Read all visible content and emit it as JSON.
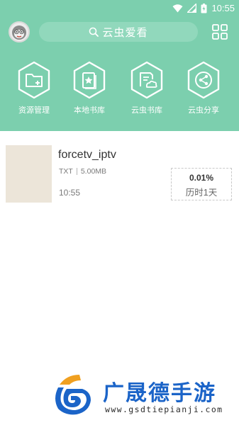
{
  "colors": {
    "header_bg": "#7ccfae",
    "search_bg": "#91d8bc",
    "cover_bg": "#ece5d9",
    "watermark_blue": "#1b64c8"
  },
  "status_bar": {
    "time": "10:55",
    "icons": [
      "wifi-icon",
      "signal-icon",
      "battery-icon"
    ]
  },
  "header": {
    "avatar_icon": "avatar-face-icon",
    "search_placeholder": "云虫爱看",
    "search_icon": "search-icon",
    "menu_icon": "grid-icon"
  },
  "nav": {
    "items": [
      {
        "label": "资源管理",
        "icon": "folder-add-icon"
      },
      {
        "label": "本地书库",
        "icon": "star-book-icon"
      },
      {
        "label": "云虫书库",
        "icon": "cloud-doc-icon"
      },
      {
        "label": "云虫分享",
        "icon": "share-icon"
      }
    ]
  },
  "files": [
    {
      "name": "forcetv_iptv",
      "type": "TXT",
      "size": "5.00MB",
      "time": "10:55",
      "progress": "0.01%",
      "duration": "历时1天"
    }
  ],
  "watermark": {
    "title": "广晟德手游",
    "url": "www.gsdtiepianji.com"
  }
}
